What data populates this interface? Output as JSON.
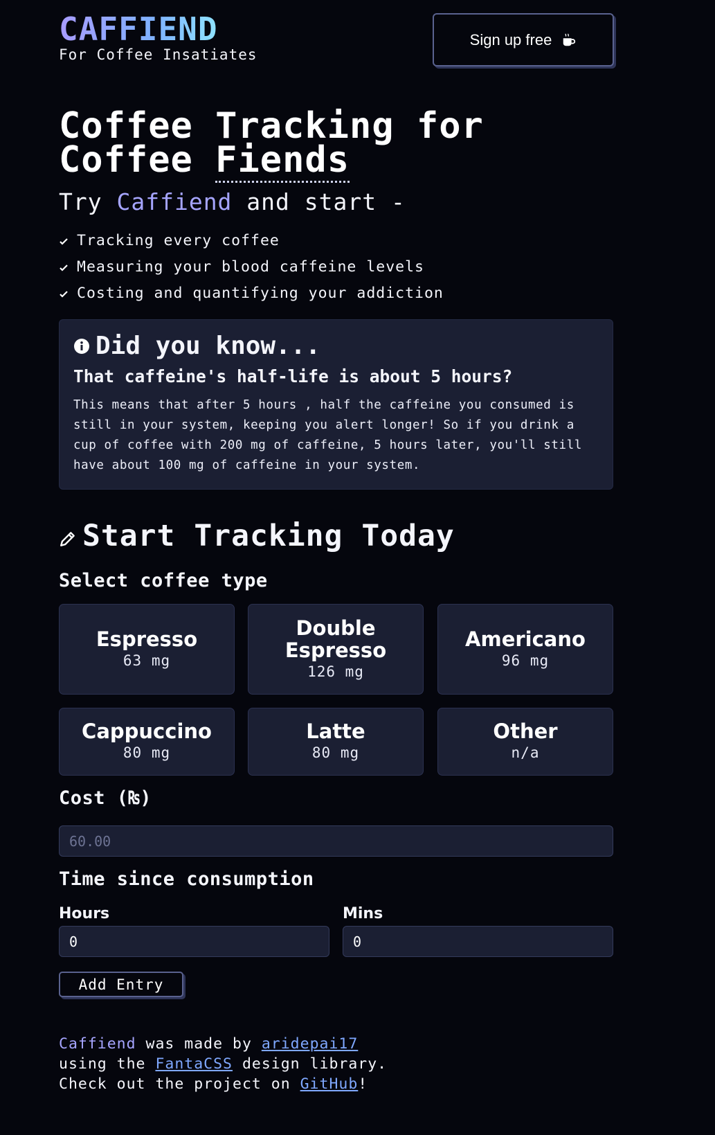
{
  "header": {
    "logo": "CAFFIEND",
    "tagline": "For Coffee Insatiates",
    "signup_label": "Sign up free",
    "signup_icon": "mug-icon"
  },
  "hero": {
    "title_part1": "Coffee Tracking for",
    "title_part2": "Coffee ",
    "title_highlight": "Fiends",
    "try_prefix": "Try ",
    "try_brand": "Caffiend",
    "try_suffix": " and start -",
    "features": [
      "Tracking every coffee",
      "Measuring your blood caffeine levels",
      "Costing and quantifying your addiction"
    ]
  },
  "did_you_know": {
    "icon": "info-circle-icon",
    "heading": "Did you know...",
    "subheading": "That caffeine's half-life is about 5 hours?",
    "body": "This means that after 5 hours , half the caffeine you consumed is still in your system, keeping you alert longer! So if you drink a cup of coffee with 200 mg of caffeine, 5 hours later, you'll still have about 100 mg of caffeine in your system."
  },
  "tracker": {
    "heading": "Start Tracking Today",
    "icon": "pencil-icon",
    "select_label": "Select coffee type",
    "coffees": [
      {
        "name": "Espresso",
        "caffeine": "63 mg"
      },
      {
        "name": "Double Espresso",
        "caffeine": "126 mg"
      },
      {
        "name": "Americano",
        "caffeine": "96 mg"
      },
      {
        "name": "Cappuccino",
        "caffeine": "80 mg"
      },
      {
        "name": "Latte",
        "caffeine": "80 mg"
      },
      {
        "name": "Other",
        "caffeine": "n/a"
      }
    ],
    "cost_label": "Cost (₨)",
    "cost_placeholder": "60.00",
    "time_label": "Time since consumption",
    "hours_label": "Hours",
    "hours_value": "0",
    "mins_label": "Mins",
    "mins_value": "0",
    "add_label": "Add Entry"
  },
  "footer": {
    "brand": "Caffiend",
    "made_by": " was made by ",
    "author": "aridepai17",
    "using": "using the ",
    "library": "FantaCSS",
    "library_suffix": " design library.",
    "check_out": "Check out the project on ",
    "github": "GitHub",
    "end": "!"
  },
  "colors": {
    "background": "#05060d",
    "card": "#1b1f33",
    "accent": "#a6a5ff",
    "link": "#7fa8ff"
  }
}
